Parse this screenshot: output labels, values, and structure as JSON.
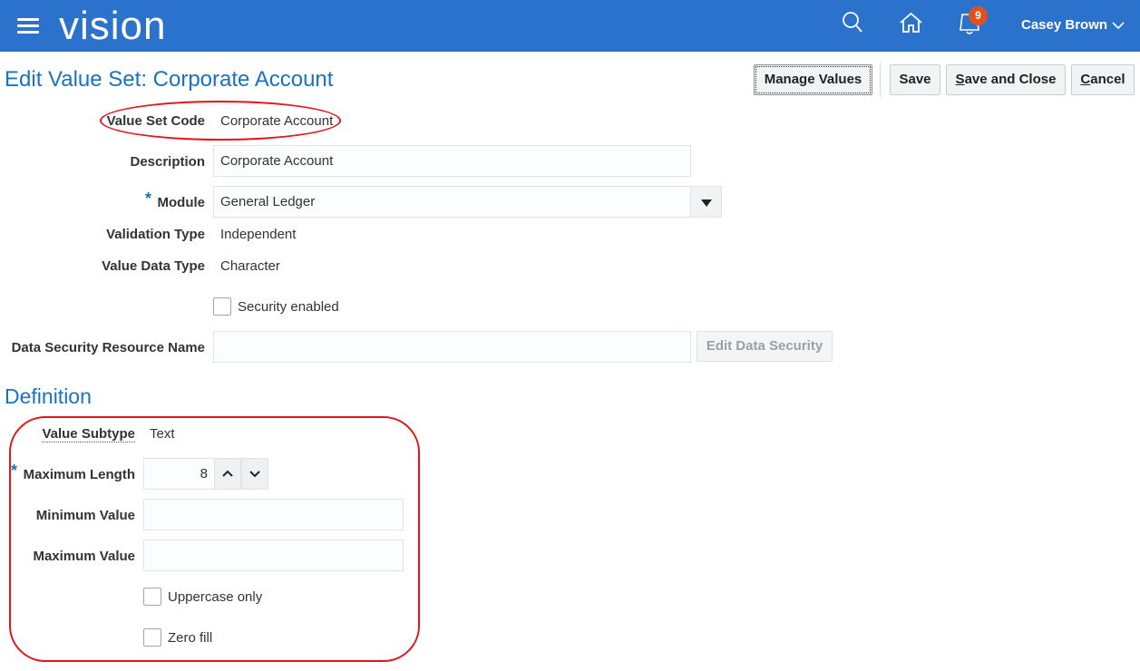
{
  "app": {
    "logo": "vision",
    "user_name": "Casey Brown",
    "notification_count": "9",
    "icons": [
      "menu-icon",
      "search-icon",
      "home-icon",
      "notifications-icon",
      "chevron-down-icon"
    ],
    "brand_color": "#2a72cb"
  },
  "page": {
    "title": "Edit Value Set: Corporate Account",
    "buttons": {
      "manage_values": "Manage Values",
      "save": "Save",
      "save_and_close": "Save and Close",
      "cancel": "Cancel"
    }
  },
  "form": {
    "value_set_code_label": "Value Set Code",
    "value_set_code": "Corporate Account",
    "description_label": "Description",
    "description": "Corporate Account",
    "module_label": "Module",
    "module": "General Ledger",
    "validation_type_label": "Validation Type",
    "validation_type": "Independent",
    "value_data_type_label": "Value Data Type",
    "value_data_type": "Character",
    "security_enabled_label": "Security enabled",
    "data_security_resource_label": "Data Security Resource Name",
    "data_security_resource": "",
    "edit_data_security": "Edit Data Security",
    "required_marker": "*"
  },
  "definition": {
    "title": "Definition",
    "value_subtype_label": "Value Subtype",
    "value_subtype": "Text",
    "maximum_length_label": "Maximum Length",
    "maximum_length": "8",
    "minimum_value_label": "Minimum Value",
    "minimum_value": "",
    "maximum_value_label": "Maximum Value",
    "maximum_value": "",
    "uppercase_only_label": "Uppercase only",
    "zero_fill_label": "Zero fill"
  },
  "annotation_color": "#e3151a"
}
